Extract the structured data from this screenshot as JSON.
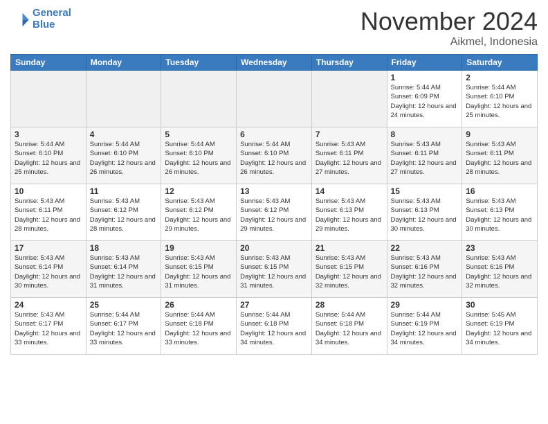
{
  "header": {
    "logo_line1": "General",
    "logo_line2": "Blue",
    "month": "November 2024",
    "location": "Aikmel, Indonesia"
  },
  "days_of_week": [
    "Sunday",
    "Monday",
    "Tuesday",
    "Wednesday",
    "Thursday",
    "Friday",
    "Saturday"
  ],
  "weeks": [
    [
      {
        "day": "",
        "info": ""
      },
      {
        "day": "",
        "info": ""
      },
      {
        "day": "",
        "info": ""
      },
      {
        "day": "",
        "info": ""
      },
      {
        "day": "",
        "info": ""
      },
      {
        "day": "1",
        "info": "Sunrise: 5:44 AM\nSunset: 6:09 PM\nDaylight: 12 hours and 24 minutes."
      },
      {
        "day": "2",
        "info": "Sunrise: 5:44 AM\nSunset: 6:10 PM\nDaylight: 12 hours and 25 minutes."
      }
    ],
    [
      {
        "day": "3",
        "info": "Sunrise: 5:44 AM\nSunset: 6:10 PM\nDaylight: 12 hours and 25 minutes."
      },
      {
        "day": "4",
        "info": "Sunrise: 5:44 AM\nSunset: 6:10 PM\nDaylight: 12 hours and 26 minutes."
      },
      {
        "day": "5",
        "info": "Sunrise: 5:44 AM\nSunset: 6:10 PM\nDaylight: 12 hours and 26 minutes."
      },
      {
        "day": "6",
        "info": "Sunrise: 5:44 AM\nSunset: 6:10 PM\nDaylight: 12 hours and 26 minutes."
      },
      {
        "day": "7",
        "info": "Sunrise: 5:43 AM\nSunset: 6:11 PM\nDaylight: 12 hours and 27 minutes."
      },
      {
        "day": "8",
        "info": "Sunrise: 5:43 AM\nSunset: 6:11 PM\nDaylight: 12 hours and 27 minutes."
      },
      {
        "day": "9",
        "info": "Sunrise: 5:43 AM\nSunset: 6:11 PM\nDaylight: 12 hours and 28 minutes."
      }
    ],
    [
      {
        "day": "10",
        "info": "Sunrise: 5:43 AM\nSunset: 6:11 PM\nDaylight: 12 hours and 28 minutes."
      },
      {
        "day": "11",
        "info": "Sunrise: 5:43 AM\nSunset: 6:12 PM\nDaylight: 12 hours and 28 minutes."
      },
      {
        "day": "12",
        "info": "Sunrise: 5:43 AM\nSunset: 6:12 PM\nDaylight: 12 hours and 29 minutes."
      },
      {
        "day": "13",
        "info": "Sunrise: 5:43 AM\nSunset: 6:12 PM\nDaylight: 12 hours and 29 minutes."
      },
      {
        "day": "14",
        "info": "Sunrise: 5:43 AM\nSunset: 6:13 PM\nDaylight: 12 hours and 29 minutes."
      },
      {
        "day": "15",
        "info": "Sunrise: 5:43 AM\nSunset: 6:13 PM\nDaylight: 12 hours and 30 minutes."
      },
      {
        "day": "16",
        "info": "Sunrise: 5:43 AM\nSunset: 6:13 PM\nDaylight: 12 hours and 30 minutes."
      }
    ],
    [
      {
        "day": "17",
        "info": "Sunrise: 5:43 AM\nSunset: 6:14 PM\nDaylight: 12 hours and 30 minutes."
      },
      {
        "day": "18",
        "info": "Sunrise: 5:43 AM\nSunset: 6:14 PM\nDaylight: 12 hours and 31 minutes."
      },
      {
        "day": "19",
        "info": "Sunrise: 5:43 AM\nSunset: 6:15 PM\nDaylight: 12 hours and 31 minutes."
      },
      {
        "day": "20",
        "info": "Sunrise: 5:43 AM\nSunset: 6:15 PM\nDaylight: 12 hours and 31 minutes."
      },
      {
        "day": "21",
        "info": "Sunrise: 5:43 AM\nSunset: 6:15 PM\nDaylight: 12 hours and 32 minutes."
      },
      {
        "day": "22",
        "info": "Sunrise: 5:43 AM\nSunset: 6:16 PM\nDaylight: 12 hours and 32 minutes."
      },
      {
        "day": "23",
        "info": "Sunrise: 5:43 AM\nSunset: 6:16 PM\nDaylight: 12 hours and 32 minutes."
      }
    ],
    [
      {
        "day": "24",
        "info": "Sunrise: 5:43 AM\nSunset: 6:17 PM\nDaylight: 12 hours and 33 minutes."
      },
      {
        "day": "25",
        "info": "Sunrise: 5:44 AM\nSunset: 6:17 PM\nDaylight: 12 hours and 33 minutes."
      },
      {
        "day": "26",
        "info": "Sunrise: 5:44 AM\nSunset: 6:18 PM\nDaylight: 12 hours and 33 minutes."
      },
      {
        "day": "27",
        "info": "Sunrise: 5:44 AM\nSunset: 6:18 PM\nDaylight: 12 hours and 34 minutes."
      },
      {
        "day": "28",
        "info": "Sunrise: 5:44 AM\nSunset: 6:18 PM\nDaylight: 12 hours and 34 minutes."
      },
      {
        "day": "29",
        "info": "Sunrise: 5:44 AM\nSunset: 6:19 PM\nDaylight: 12 hours and 34 minutes."
      },
      {
        "day": "30",
        "info": "Sunrise: 5:45 AM\nSunset: 6:19 PM\nDaylight: 12 hours and 34 minutes."
      }
    ]
  ]
}
